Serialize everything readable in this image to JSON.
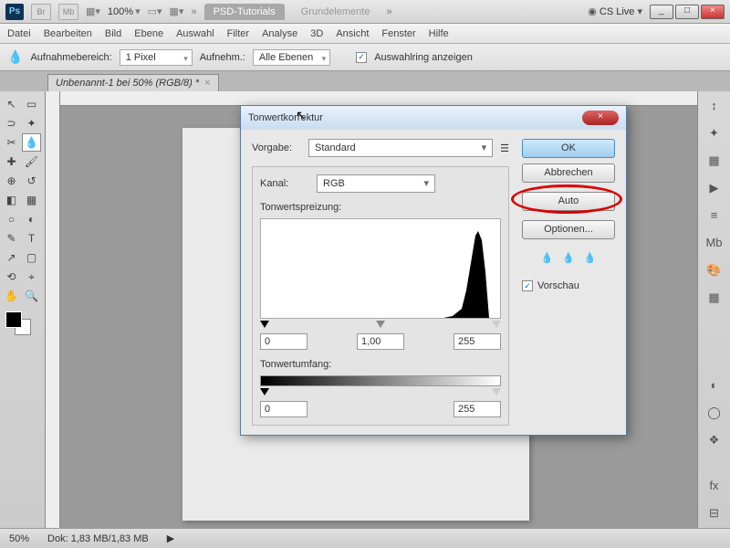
{
  "top": {
    "percent": "100%",
    "tab1": "PSD-Tutorials",
    "tab2": "Grundelemente",
    "cslive": "CS Live"
  },
  "menu": [
    "Datei",
    "Bearbeiten",
    "Bild",
    "Ebene",
    "Auswahl",
    "Filter",
    "Analyse",
    "3D",
    "Ansicht",
    "Fenster",
    "Hilfe"
  ],
  "options": {
    "aufnahme": "Aufnahmebereich:",
    "px": "1 Pixel",
    "aufnehm": "Aufnehm.:",
    "alle": "Alle Ebenen",
    "ring": "Auswahlring anzeigen"
  },
  "doctab": "Unbenannt-1 bei 50% (RGB/8) *",
  "status": {
    "zoom": "50%",
    "dok": "Dok: 1,83 MB/1,83 MB"
  },
  "dialog": {
    "title": "Tonwertkorrektur",
    "vorgabe": "Vorgabe:",
    "vorgabe_v": "Standard",
    "kanal": "Kanal:",
    "kanal_v": "RGB",
    "spreizung": "Tonwertspreizung:",
    "umfang": "Tonwertumfang:",
    "in": [
      "0",
      "1,00",
      "255"
    ],
    "out": [
      "0",
      "255"
    ],
    "ok": "OK",
    "abbrechen": "Abbrechen",
    "auto": "Auto",
    "optionen": "Optionen...",
    "vorschau": "Vorschau"
  }
}
